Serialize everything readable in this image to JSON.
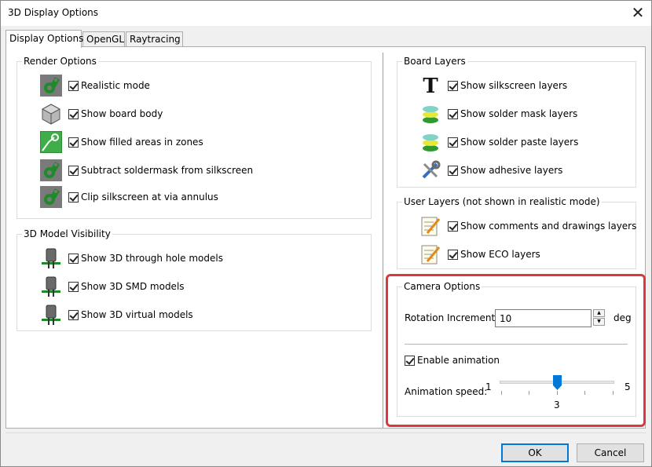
{
  "window": {
    "title": "3D Display Options",
    "close_glyph": "✕"
  },
  "tabs": [
    {
      "label": "Display Options",
      "active": true
    },
    {
      "label": "OpenGL"
    },
    {
      "label": "Raytracing"
    }
  ],
  "render_options": {
    "title": "Render Options",
    "items": [
      {
        "label": "Realistic mode",
        "icon": "realistic-mode-icon",
        "checked": true
      },
      {
        "label": "Show board body",
        "icon": "board-body-cube-icon",
        "checked": true
      },
      {
        "label": "Show filled areas in zones",
        "icon": "zone-fill-icon",
        "checked": true
      },
      {
        "label": "Subtract soldermask from silkscreen",
        "icon": "soldermask-icon",
        "checked": true
      },
      {
        "label": "Clip silkscreen at via annulus",
        "icon": "via-annulus-icon",
        "checked": true
      }
    ]
  },
  "model_visibility": {
    "title": "3D Model Visibility",
    "items": [
      {
        "label": "Show 3D through hole models",
        "icon": "through-hole-model-icon",
        "checked": true
      },
      {
        "label": "Show 3D SMD models",
        "icon": "smd-model-icon",
        "checked": true
      },
      {
        "label": "Show 3D virtual models",
        "icon": "virtual-model-icon",
        "checked": true
      }
    ]
  },
  "board_layers": {
    "title": "Board Layers",
    "items": [
      {
        "label": "Show silkscreen layers",
        "icon": "text-t-icon",
        "checked": true
      },
      {
        "label": "Show solder mask layers",
        "icon": "solder-mask-layers-icon",
        "checked": true
      },
      {
        "label": "Show solder paste layers",
        "icon": "solder-paste-layers-icon",
        "checked": true
      },
      {
        "label": "Show adhesive layers",
        "icon": "tools-icon",
        "checked": true
      }
    ]
  },
  "user_layers": {
    "title": "User Layers (not shown in realistic mode)",
    "items": [
      {
        "label": "Show comments and drawings layers",
        "icon": "notepad-pencil-icon",
        "checked": true
      },
      {
        "label": "Show ECO layers",
        "icon": "notepad-pencil-icon",
        "checked": true
      }
    ]
  },
  "camera": {
    "title": "Camera Options",
    "rotation_label": "Rotation Increment:",
    "rotation_value": "10",
    "rotation_unit": "deg",
    "enable_animation_label": "Enable animation",
    "enable_animation_checked": true,
    "speed_label": "Animation speed:",
    "speed_min": "1",
    "speed_max": "5",
    "speed_value": "3",
    "speed_level": 3
  },
  "buttons": {
    "ok": "OK",
    "cancel": "Cancel"
  },
  "colors": {
    "highlight": "#d9383e",
    "slider_thumb": "#0078d7",
    "icon_green": "#1f8a2a"
  }
}
